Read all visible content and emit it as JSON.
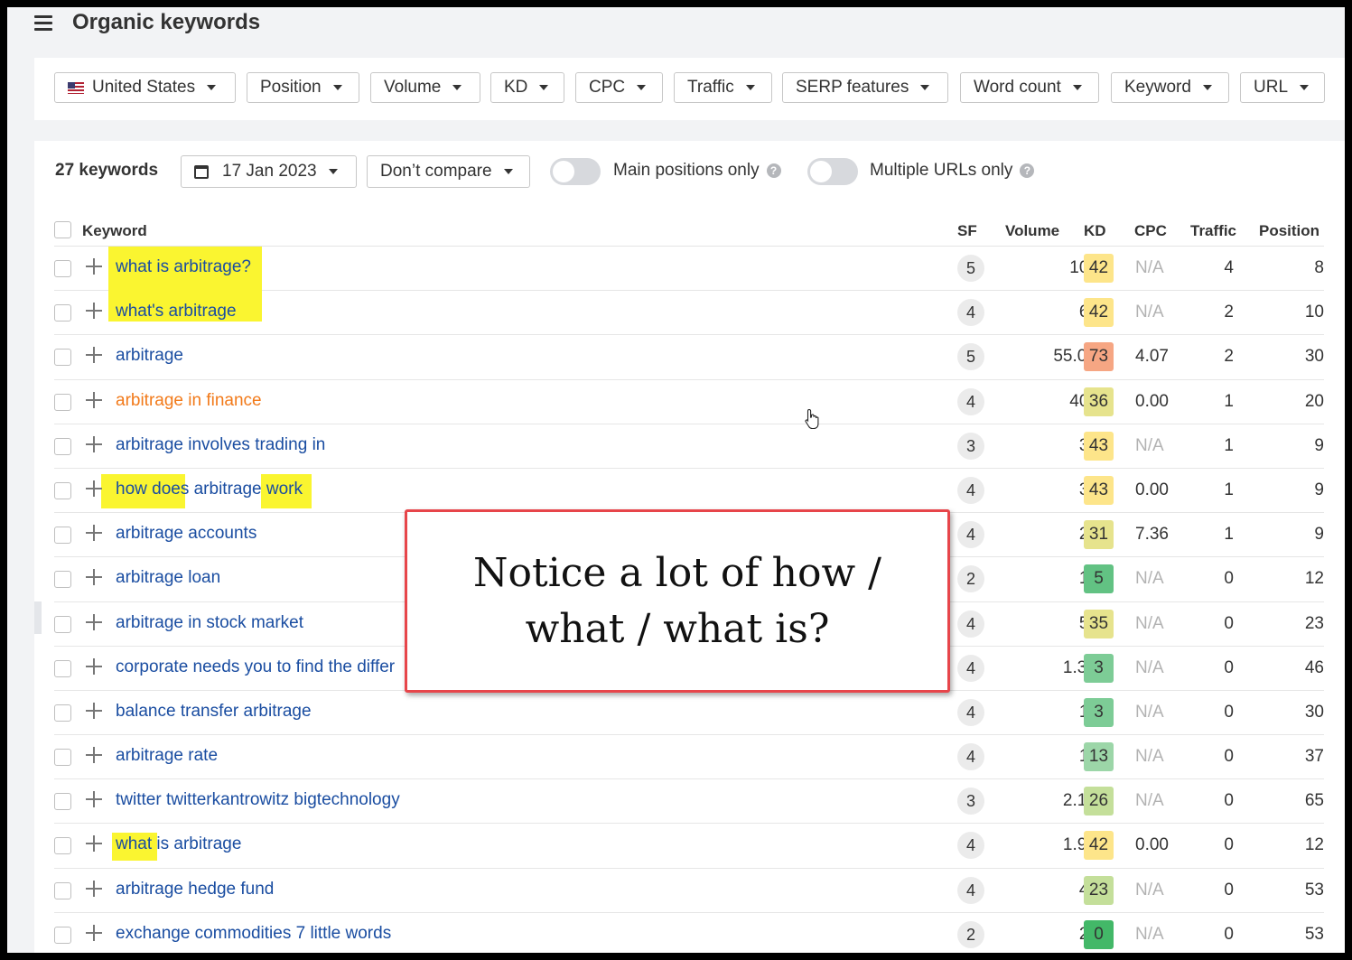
{
  "header": {
    "title": "Organic keywords"
  },
  "filters": [
    {
      "label": "United States",
      "flag": true
    },
    {
      "label": "Position"
    },
    {
      "label": "Volume"
    },
    {
      "label": "KD"
    },
    {
      "label": "CPC"
    },
    {
      "label": "Traffic"
    },
    {
      "label": "SERP features"
    },
    {
      "label": "Word count"
    },
    {
      "label": "Keyword"
    },
    {
      "label": "URL"
    }
  ],
  "toolbar": {
    "count": "27 keywords",
    "date": "17 Jan 2023",
    "compare": "Don’t compare",
    "main_positions": "Main positions only",
    "multiple_urls": "Multiple URLs only",
    "help": "?"
  },
  "columns": {
    "keyword": "Keyword",
    "sf": "SF",
    "volume": "Volume",
    "kd": "KD",
    "cpc": "CPC",
    "traffic": "Traffic",
    "position": "Position"
  },
  "rows": [
    {
      "keyword": "what is arbitrage?",
      "sf": "5",
      "volume": "100",
      "kd": "42",
      "cpc": "N/A",
      "traffic": "4",
      "position": "8"
    },
    {
      "keyword": "what's arbitrage",
      "sf": "4",
      "volume": "60",
      "kd": "42",
      "cpc": "N/A",
      "traffic": "2",
      "position": "10"
    },
    {
      "keyword": "arbitrage",
      "sf": "5",
      "volume": "55.0K",
      "kd": "73",
      "cpc": "4.07",
      "traffic": "2",
      "position": "30"
    },
    {
      "keyword": "arbitrage in finance",
      "sf": "4",
      "volume": "400",
      "kd": "36",
      "cpc": "0.00",
      "traffic": "1",
      "position": "20",
      "visited": true
    },
    {
      "keyword": "arbitrage involves trading in",
      "sf": "3",
      "volume": "30",
      "kd": "43",
      "cpc": "N/A",
      "traffic": "1",
      "position": "9"
    },
    {
      "keyword": "how does arbitrage work",
      "sf": "4",
      "volume": "30",
      "kd": "43",
      "cpc": "0.00",
      "traffic": "1",
      "position": "9"
    },
    {
      "keyword": "arbitrage accounts",
      "sf": "4",
      "volume": "20",
      "kd": "31",
      "cpc": "7.36",
      "traffic": "1",
      "position": "9"
    },
    {
      "keyword": "arbitrage loan",
      "sf": "2",
      "volume": "10",
      "kd": "5",
      "cpc": "N/A",
      "traffic": "0",
      "position": "12"
    },
    {
      "keyword": "arbitrage in stock market",
      "sf": "4",
      "volume": "50",
      "kd": "35",
      "cpc": "N/A",
      "traffic": "0",
      "position": "23"
    },
    {
      "keyword": "corporate needs you to find the differ",
      "sf": "4",
      "volume": "1.3K",
      "kd": "3",
      "cpc": "N/A",
      "traffic": "0",
      "position": "46"
    },
    {
      "keyword": "balance transfer arbitrage",
      "sf": "4",
      "volume": "10",
      "kd": "3",
      "cpc": "N/A",
      "traffic": "0",
      "position": "30"
    },
    {
      "keyword": "arbitrage rate",
      "sf": "4",
      "volume": "10",
      "kd": "13",
      "cpc": "N/A",
      "traffic": "0",
      "position": "37"
    },
    {
      "keyword": "twitter twitterkantrowitz bigtechnology",
      "sf": "3",
      "volume": "2.1K",
      "kd": "26",
      "cpc": "N/A",
      "traffic": "0",
      "position": "65"
    },
    {
      "keyword": "what is arbitrage",
      "sf": "4",
      "volume": "1.9K",
      "kd": "42",
      "cpc": "0.00",
      "traffic": "0",
      "position": "12"
    },
    {
      "keyword": "arbitrage hedge fund",
      "sf": "4",
      "volume": "40",
      "kd": "23",
      "cpc": "N/A",
      "traffic": "0",
      "position": "53"
    },
    {
      "keyword": "exchange commodities 7 little words",
      "sf": "2",
      "volume": "20",
      "kd": "0",
      "cpc": "N/A",
      "traffic": "0",
      "position": "53"
    }
  ],
  "kd_colors": {
    "0": "#43b868",
    "3": "#7dcc96",
    "5": "#62c283",
    "13": "#9cd6a8",
    "23": "#c4df9a",
    "26": "#c4df9a",
    "31": "#e6e38d",
    "35": "#e6e38d",
    "36": "#e6e38d",
    "42": "#fde58a",
    "43": "#fde58a",
    "73": "#f6a683"
  },
  "annotation": {
    "text": "Notice a lot of how / what / what is?"
  }
}
